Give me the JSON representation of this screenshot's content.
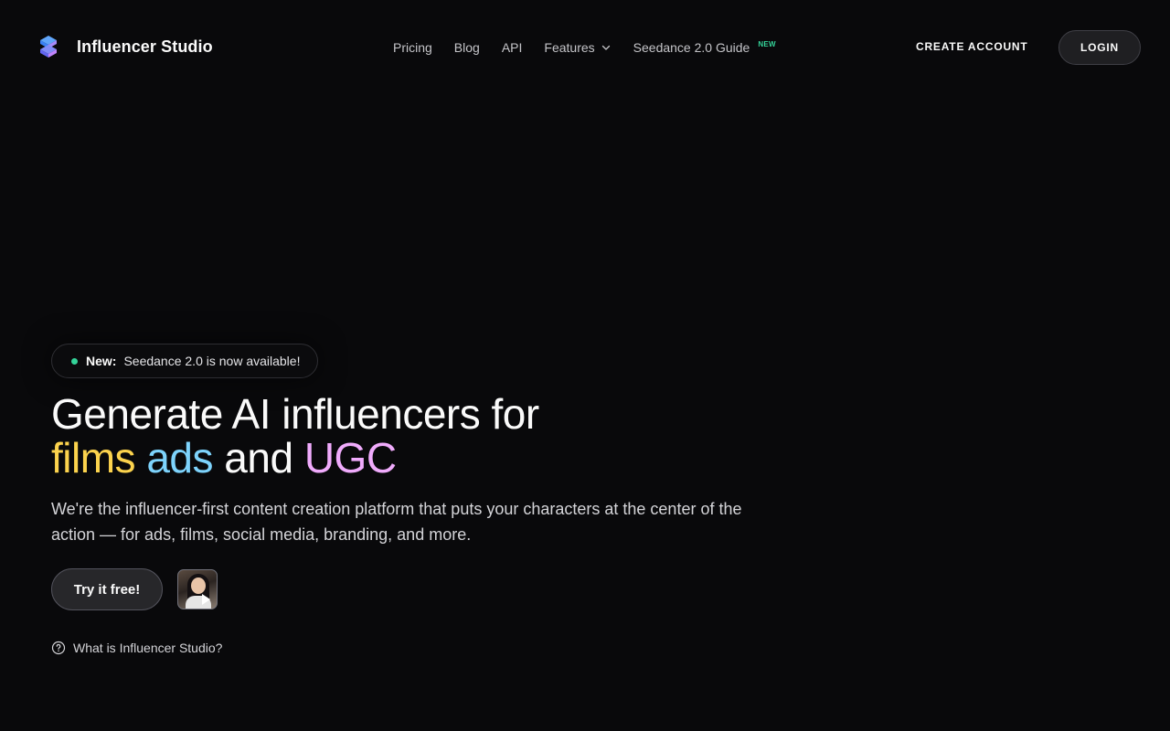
{
  "brand": {
    "name": "Influencer Studio",
    "logo_icon": "influencer-studio-logo"
  },
  "nav": {
    "items": [
      {
        "label": "Pricing"
      },
      {
        "label": "Blog"
      },
      {
        "label": "API"
      },
      {
        "label": "Features",
        "icon": "chevron-down-icon"
      },
      {
        "label": "Seedance 2.0 Guide",
        "badge": "NEW"
      }
    ]
  },
  "header": {
    "create_account": "CREATE ACCOUNT",
    "login": "LOGIN"
  },
  "announcement": {
    "prefix": "New:",
    "text": "Seedance 2.0 is now available!",
    "dot_color": "#34d399"
  },
  "hero": {
    "headline_line1": "Generate AI influencers for",
    "word1": "films",
    "word2": "ads",
    "joiner": "and",
    "word3": "UGC",
    "subcopy": "We're the influencer-first content creation platform that puts your characters at the center of the action — for ads, films, social media, branding, and more.",
    "cta": "Try it free!",
    "help_link": "What is Influencer Studio?"
  },
  "colors": {
    "background": "#09090b",
    "films": "#fcd34d",
    "ads": "#7dd3fc",
    "ugc": "#f0abfc",
    "new_badge": "#34d399"
  }
}
